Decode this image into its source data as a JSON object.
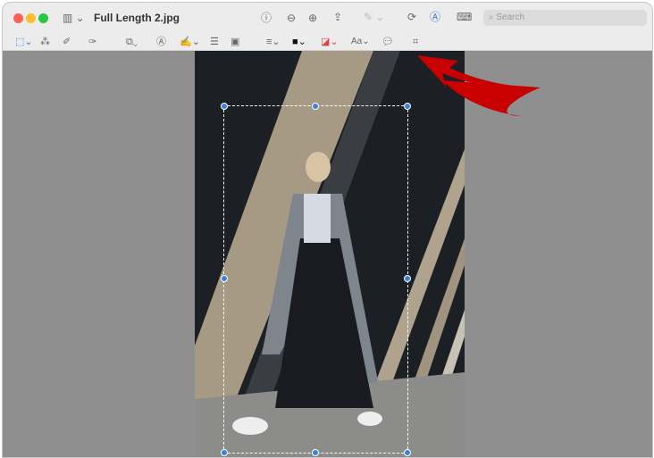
{
  "window": {
    "title": "Full Length 2.jpg"
  },
  "toolbar": {
    "search_placeholder": "Search"
  },
  "markup": {
    "text_style_label": "Aa"
  },
  "colors": {
    "accent": "#2f6fe0",
    "arrow": "#d00000",
    "canvas": "#8f8f8f"
  }
}
